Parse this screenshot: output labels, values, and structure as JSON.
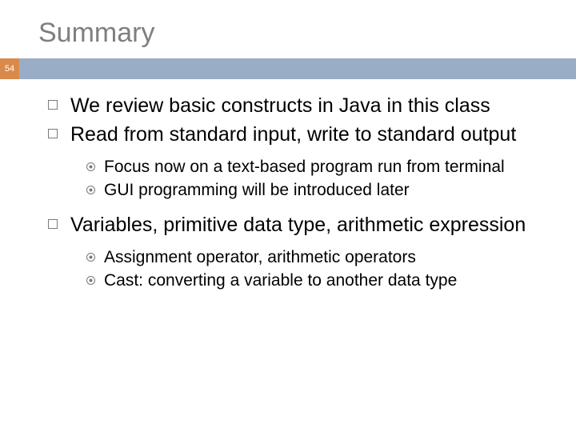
{
  "slide": {
    "title": "Summary",
    "number": "54",
    "bullets": [
      {
        "level": 1,
        "text": "We review basic constructs in Java in this class"
      },
      {
        "level": 1,
        "text": "Read from standard input, write to standard output"
      },
      {
        "level": 2,
        "text": "Focus now on a text-based program run from terminal"
      },
      {
        "level": 2,
        "text": "GUI programming will be introduced later"
      },
      {
        "level": 1,
        "text": "Variables, primitive data type, arithmetic expression"
      },
      {
        "level": 2,
        "text": "Assignment operator, arithmetic operators"
      },
      {
        "level": 2,
        "text": "Cast: converting a variable to another data type"
      }
    ]
  }
}
